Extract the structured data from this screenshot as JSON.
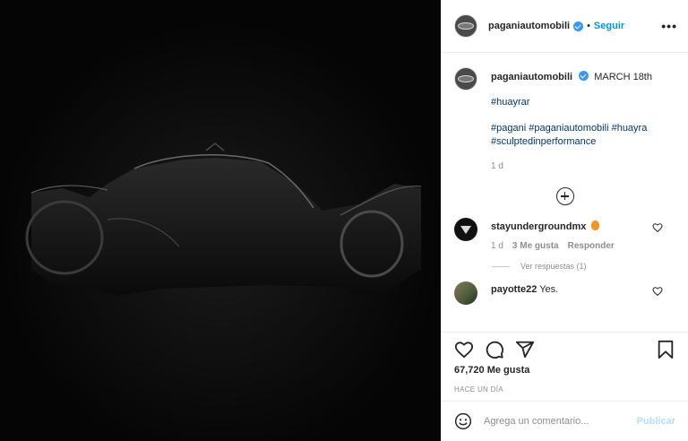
{
  "post": {
    "username": "paganiautomobili",
    "follow_label": "Seguir",
    "separator": "•",
    "more_label": "•••"
  },
  "caption": {
    "username": "paganiautomobili",
    "date": "MARCH 18th",
    "tag1": "#huayrar",
    "tags": [
      "#pagani",
      "#paganiautomobili",
      "#huayra",
      "#sculptedinperformance"
    ],
    "age": "1 d"
  },
  "comments": [
    {
      "username": "stayundergroundmx",
      "text": "",
      "age": "1 d",
      "likes": "3 Me gusta",
      "reply_label": "Responder"
    },
    {
      "username": "payotte22",
      "text": "Yes."
    }
  ],
  "view_replies": "Ver respuestas (1)",
  "likes_count": "67,720 Me gusta",
  "time_ago": "HACE UN DÍA",
  "add_comment": {
    "placeholder": "Agrega un comentario...",
    "publish_label": "Publicar"
  },
  "colors": {
    "accent": "#0095f6",
    "verified": "#3897f0",
    "publish_disabled": "#b2dffc"
  }
}
